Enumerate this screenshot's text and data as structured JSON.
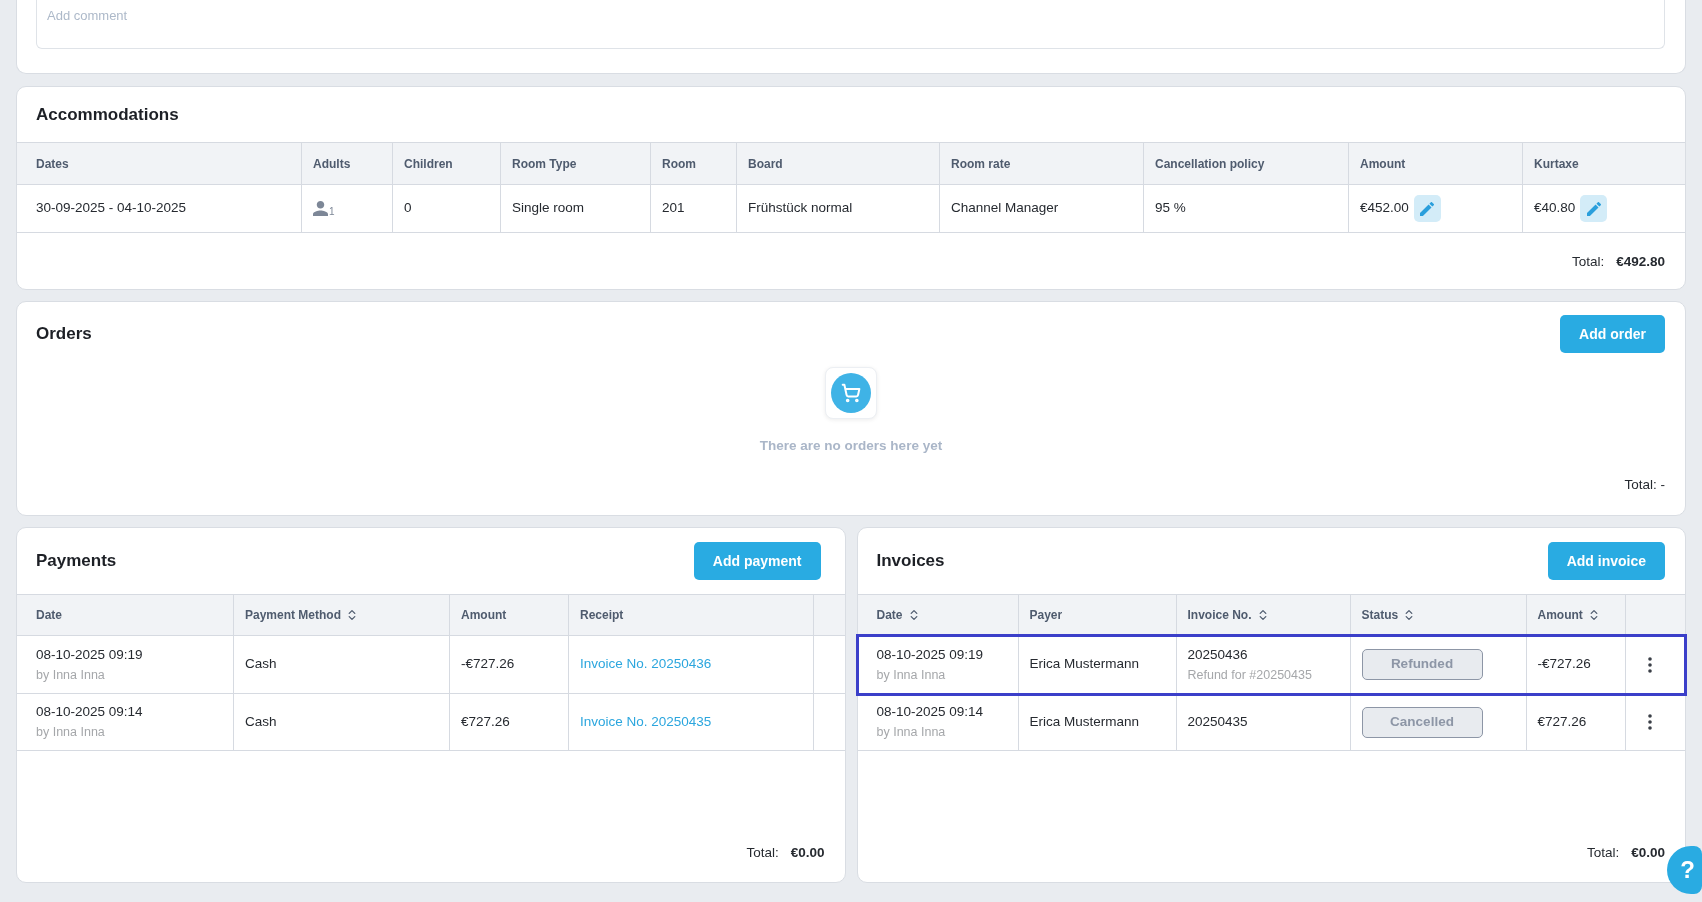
{
  "comment": {
    "placeholder": "Add comment"
  },
  "accommodations": {
    "title": "Accommodations",
    "columns": [
      {
        "label": "Dates"
      },
      {
        "label": "Adults"
      },
      {
        "label": "Children"
      },
      {
        "label": "Room Type"
      },
      {
        "label": "Room"
      },
      {
        "label": "Board"
      },
      {
        "label": "Room rate"
      },
      {
        "label": "Cancellation policy"
      },
      {
        "label": "Amount"
      },
      {
        "label": "Kurtaxe"
      }
    ],
    "rows": [
      {
        "cells": [
          {
            "kind": "text",
            "text": "30-09-2025 - 04-10-2025"
          },
          {
            "kind": "guests",
            "text": "1"
          },
          {
            "kind": "text",
            "text": "0"
          },
          {
            "kind": "text",
            "text": "Single room"
          },
          {
            "kind": "text",
            "text": "201"
          },
          {
            "kind": "text",
            "text": "Frühstück normal"
          },
          {
            "kind": "text",
            "text": "Channel Manager"
          },
          {
            "kind": "text",
            "text": "95 %"
          },
          {
            "kind": "editable",
            "text": "€452.00"
          },
          {
            "kind": "editable",
            "text": "€40.80"
          }
        ]
      }
    ],
    "total_label": "Total:",
    "total_value": "€492.80"
  },
  "orders": {
    "title": "Orders",
    "add_button": "Add order",
    "empty_text": "There are no orders here yet",
    "total_label": "Total: -"
  },
  "payments": {
    "title": "Payments",
    "add_button": "Add payment",
    "columns": [
      {
        "label": "Date",
        "sortable": false
      },
      {
        "label": "Payment Method",
        "sortable": true
      },
      {
        "label": "Amount",
        "sortable": false
      },
      {
        "label": "Receipt",
        "sortable": false
      }
    ],
    "rows": [
      {
        "cells": [
          {
            "kind": "datetime",
            "text": "08-10-2025 09:19",
            "sub": "by Inna Inna"
          },
          {
            "kind": "text",
            "text": "Cash"
          },
          {
            "kind": "text",
            "text": "-€727.26"
          },
          {
            "kind": "link",
            "text": "Invoice No. 20250436"
          }
        ]
      },
      {
        "cells": [
          {
            "kind": "datetime",
            "text": "08-10-2025 09:14",
            "sub": "by Inna Inna"
          },
          {
            "kind": "text",
            "text": "Cash"
          },
          {
            "kind": "text",
            "text": "€727.26"
          },
          {
            "kind": "link",
            "text": "Invoice No. 20250435"
          }
        ]
      }
    ],
    "total_label": "Total:",
    "total_value": "€0.00"
  },
  "invoices": {
    "title": "Invoices",
    "add_button": "Add invoice",
    "columns": [
      {
        "label": "Date",
        "sortable": true
      },
      {
        "label": "Payer",
        "sortable": false
      },
      {
        "label": "Invoice No.",
        "sortable": true
      },
      {
        "label": "Status",
        "sortable": true
      },
      {
        "label": "Amount",
        "sortable": true
      }
    ],
    "rows": [
      {
        "selected": true,
        "cells": [
          {
            "kind": "datetime",
            "text": "08-10-2025 09:19",
            "sub": "by Inna Inna"
          },
          {
            "kind": "text",
            "text": "Erica Mustermann"
          },
          {
            "kind": "invoice_number",
            "text": "20250436",
            "sub": "Refund for #20250435"
          },
          {
            "kind": "status",
            "text": "Refunded"
          },
          {
            "kind": "text",
            "text": "-€727.26"
          },
          {
            "kind": "menu"
          }
        ]
      },
      {
        "selected": false,
        "cells": [
          {
            "kind": "datetime",
            "text": "08-10-2025 09:14",
            "sub": "by Inna Inna"
          },
          {
            "kind": "text",
            "text": "Erica Mustermann"
          },
          {
            "kind": "invoice_number",
            "text": "20250435"
          },
          {
            "kind": "status",
            "text": "Cancelled"
          },
          {
            "kind": "text",
            "text": "€727.26"
          },
          {
            "kind": "menu"
          }
        ]
      }
    ],
    "total_label": "Total:",
    "total_value": "€0.00"
  },
  "help_button": {
    "label": "?"
  }
}
